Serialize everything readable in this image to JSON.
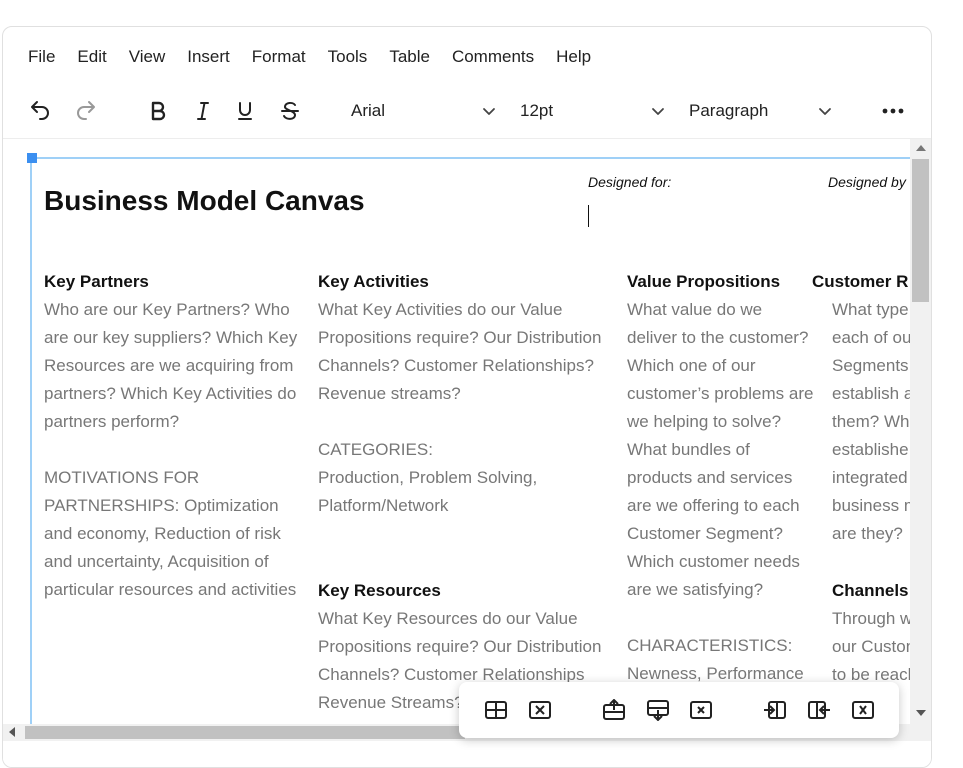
{
  "menubar": {
    "items": [
      "File",
      "Edit",
      "View",
      "Insert",
      "Format",
      "Tools",
      "Table",
      "Comments",
      "Help"
    ]
  },
  "toolbar": {
    "icons": [
      "undo-icon",
      "redo-icon",
      "bold-icon",
      "italic-icon",
      "underline-icon",
      "strikethrough-icon",
      "more-icon"
    ],
    "font_family": "Arial",
    "font_size": "12pt",
    "block_format": "Paragraph"
  },
  "document": {
    "title": "Business Model Canvas",
    "designed_for_label": "Designed for:",
    "designed_by_label": "Designed by",
    "key_partners": {
      "heading": "Key Partners",
      "body": "Who are our Key Partners? Who are our key suppliers? Which Key Resources are we acquiring from partners? Which Key Activities do partners perform?\n\nMOTIVATIONS FOR PARTNERSHIPS: Optimization and economy, Reduction of risk and uncertainty, Acquisition of particular resources and activities"
    },
    "key_activities": {
      "heading": "Key Activities",
      "body": "What Key Activities do our Value Propositions require? Our Distribution Channels? Customer Relationships? Revenue streams?\n\nCATEGORIES:\nProduction, Problem Solving, Platform/Network"
    },
    "key_resources": {
      "heading": "Key Resources",
      "body": "What Key Resources do our Value Propositions require? Our Distribution Channels? Customer Relationships Revenue Streams?"
    },
    "value_propositions": {
      "heading": "Value Propositions",
      "body": "What value do we deliver to the customer? Which one of our customer’s problems are we helping to solve? What bundles of products and services are we offering to each Customer Segment? Which customer needs are we satisfying?\n\nCHARACTERISTICS:\nNewness, Performance"
    },
    "customer_relationships": {
      "heading": "Customer R",
      "body": "What type\neach of ou\nSegments\nestablish a\nthem? Wh\nestablishe\nintegrated\nbusiness m\nare they?"
    },
    "channels": {
      "heading": "Channels",
      "body": "Through w\nour Custon\nto be reach"
    }
  },
  "table_popup": {
    "icons": [
      "table-properties-icon",
      "delete-table-icon",
      "insert-row-before-icon",
      "insert-row-after-icon",
      "delete-row-icon",
      "insert-column-before-icon",
      "insert-column-after-icon",
      "delete-column-icon"
    ]
  }
}
